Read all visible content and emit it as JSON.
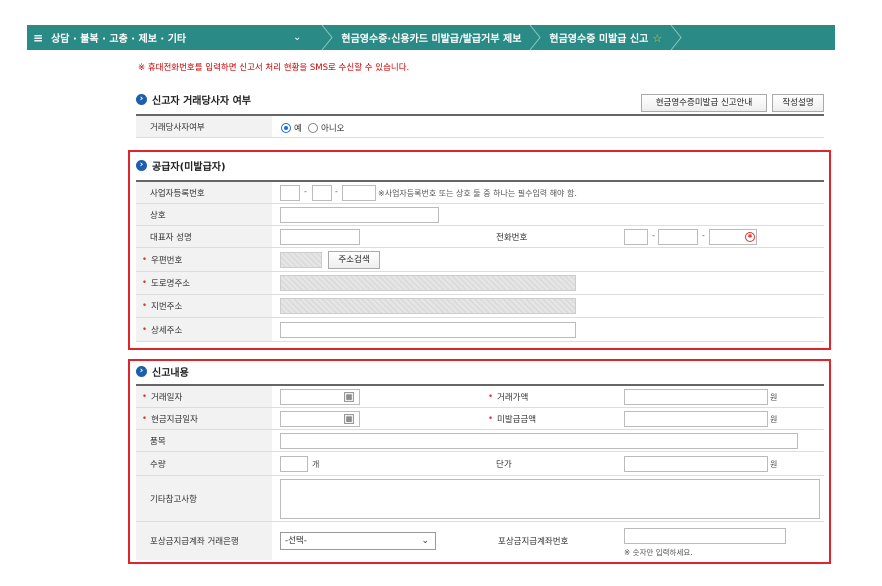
{
  "topbar": {
    "menu_icon": "hamburger-icon",
    "menu_label": "≡",
    "menu_title": "상담 · 불복 · 고충 · 제보 · 기타",
    "chevron": "⌄",
    "crumb1": "현금영수증·신용카드 미발급/발급거부 제보",
    "crumb2": "현금영수증 미발급 신고",
    "star": "☆"
  },
  "notice": "※ 휴대전화번호를 입력하면 신고서 처리 현황을 SMS로 수신할 수 있습니다.",
  "reporter": {
    "title": "신고자 거래당사자 여부",
    "guide_button": "현금영수증미발급 신고안내",
    "howto_button": "작성설명",
    "party_label": "거래당사자여부",
    "yes_label": "예",
    "no_label": "아니오"
  },
  "supplier": {
    "title": "공급자(미발급자)",
    "biz_no_label": "사업자등록번호",
    "biz_no_hint": "※사업자등록번호 또는 상호 둘 중 하나는 필수입력 해야 함.",
    "trade_name_label": "상호",
    "ceo_label": "대표자 성명",
    "phone_label": "전화번호",
    "zip_label": "우편번호",
    "address_search_button": "주소검색",
    "road_addr_label": "도로명주소",
    "lot_addr_label": "지번주소",
    "detail_addr_label": "상세주소",
    "dash": "-",
    "req_mark": "•"
  },
  "report": {
    "title": "신고내용",
    "trade_date_label": "거래일자",
    "amount_label": "거래가액",
    "cash_date_label": "현금지급일자",
    "unissued_label": "미발급금액",
    "item_label": "품목",
    "qty_label": "수량",
    "qty_unit": "개",
    "price_label": "단가",
    "won": "원",
    "other_label": "기타참고사항",
    "bank_label": "포상금지급계좌 거래은행",
    "bank_select": "-선택-",
    "account_label": "포상금지급계좌번호",
    "account_hint": "※ 숫자만 입력하세요.",
    "req_mark": "•"
  },
  "colors": {
    "topbar": "#2a8a85",
    "highlight": "#e0242c",
    "accent": "#1d5fae"
  }
}
